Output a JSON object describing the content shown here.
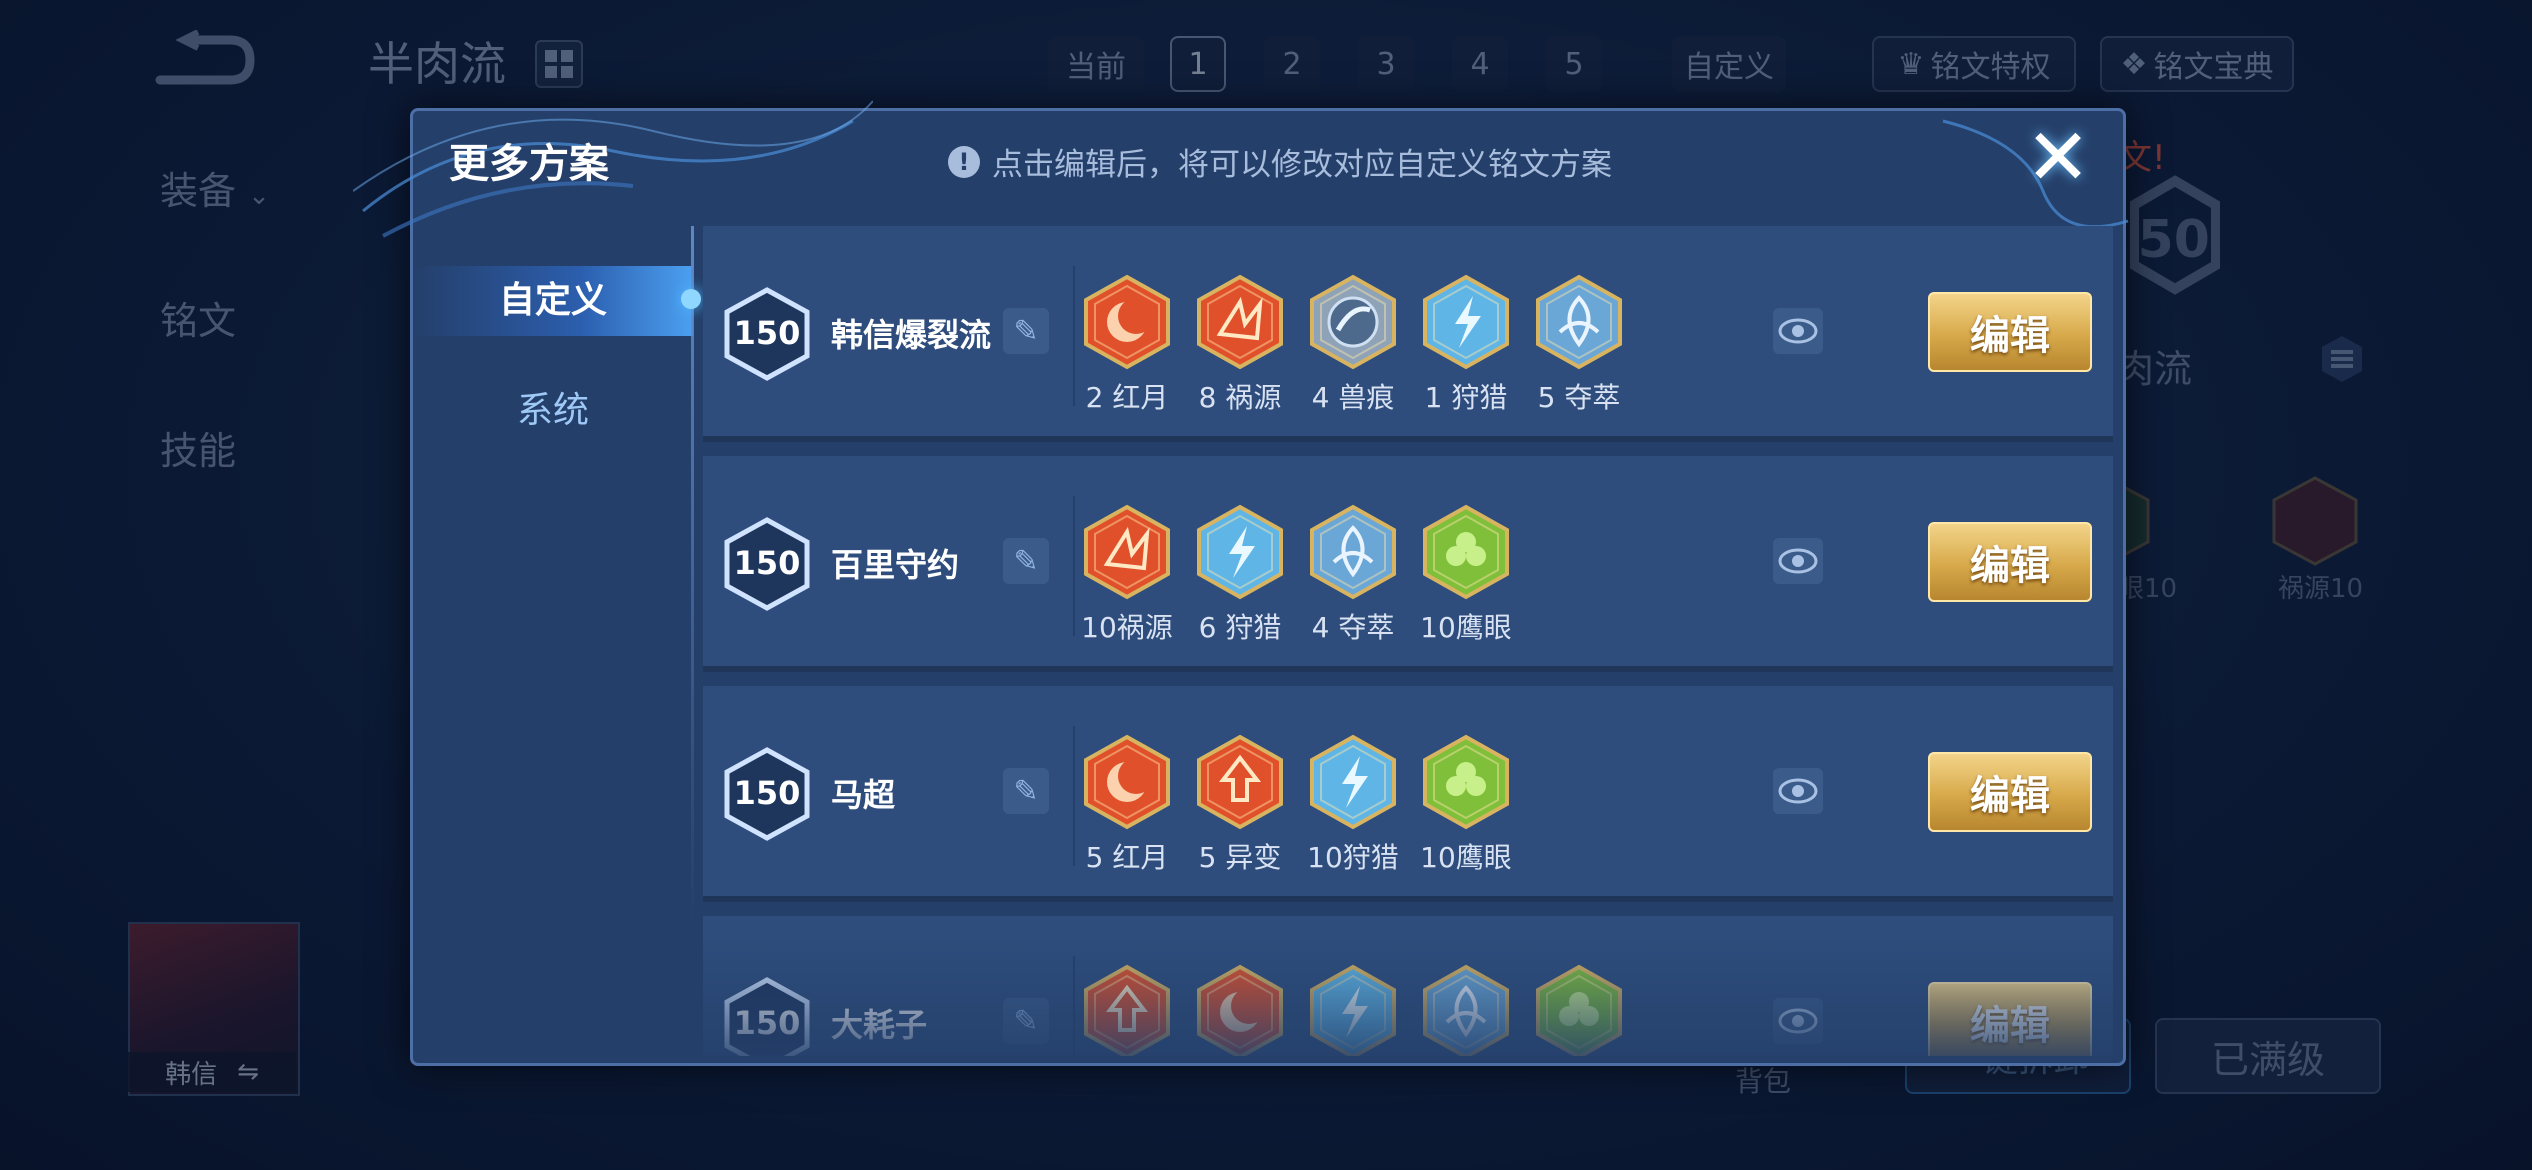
{
  "background": {
    "title": "半肉流",
    "sidebar": [
      "装备",
      "铭文",
      "技能"
    ],
    "tabs": {
      "current_label": "当前",
      "pages": [
        "1",
        "2",
        "3",
        "4",
        "5"
      ],
      "custom_label": "自定义"
    },
    "privilege_button": "铭文特权",
    "codex_button": "铭文宝典",
    "notice_fragment": "文!",
    "level_fragment": "50",
    "plan_name_fragment": "肉流",
    "rune_fragments": [
      "眼10",
      "祸源10"
    ],
    "bag_label": "背包",
    "one_click_label": "一键拆卸",
    "max_level_label": "已满级",
    "hero_name": "韩信",
    "swap_glyph": "⇋"
  },
  "dialog": {
    "title": "更多方案",
    "hint": "点击编辑后，将可以修改对应自定义铭文方案",
    "hint_icon": "!",
    "close_glyph": "✕",
    "tabs": [
      {
        "label": "自定义",
        "active": true
      },
      {
        "label": "系统",
        "active": false
      }
    ],
    "edit_label": "编辑",
    "plans": [
      {
        "level": "150",
        "name": "韩信爆裂流",
        "runes": [
          {
            "label": "2 红月",
            "color": "#e0502a",
            "icon": "moon-icon"
          },
          {
            "label": "8 祸源",
            "color": "#e0502a",
            "icon": "shards-icon"
          },
          {
            "label": "4 兽痕",
            "color": "#8fa3b8",
            "icon": "claw-icon"
          },
          {
            "label": "1 狩猎",
            "color": "#5fb6e6",
            "icon": "bolt-icon"
          },
          {
            "label": "5 夺萃",
            "color": "#6aa6d6",
            "icon": "knot-icon"
          }
        ]
      },
      {
        "level": "150",
        "name": "百里守约",
        "runes": [
          {
            "label": "10祸源",
            "color": "#e0502a",
            "icon": "shards-icon"
          },
          {
            "label": "6 狩猎",
            "color": "#5fb6e6",
            "icon": "bolt-icon"
          },
          {
            "label": "4 夺萃",
            "color": "#6aa6d6",
            "icon": "knot-icon"
          },
          {
            "label": "10鹰眼",
            "color": "#7fbf3a",
            "icon": "clover-icon"
          }
        ]
      },
      {
        "level": "150",
        "name": "马超",
        "runes": [
          {
            "label": "5 红月",
            "color": "#e0502a",
            "icon": "moon-icon"
          },
          {
            "label": "5 异变",
            "color": "#e0502a",
            "icon": "arrow-icon"
          },
          {
            "label": "10狩猎",
            "color": "#5fb6e6",
            "icon": "bolt-icon"
          },
          {
            "label": "10鹰眼",
            "color": "#7fbf3a",
            "icon": "clover-icon"
          }
        ]
      },
      {
        "level": "150",
        "name": "大耗子",
        "runes": [
          {
            "label": "",
            "color": "#e0502a",
            "icon": "arrow-icon"
          },
          {
            "label": "",
            "color": "#e0502a",
            "icon": "moon-icon"
          },
          {
            "label": "",
            "color": "#5fb6e6",
            "icon": "bolt-icon"
          },
          {
            "label": "",
            "color": "#6aa6d6",
            "icon": "knot-icon"
          },
          {
            "label": "",
            "color": "#7fbf3a",
            "icon": "clover-icon"
          }
        ]
      }
    ]
  }
}
